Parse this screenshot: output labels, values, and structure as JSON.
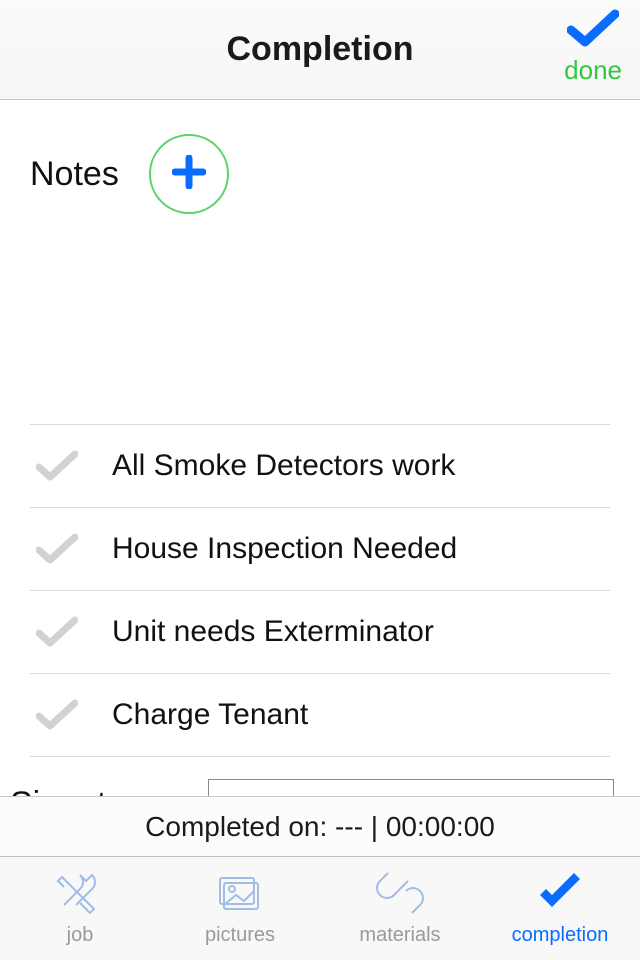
{
  "header": {
    "title": "Completion",
    "done_label": "done"
  },
  "notes": {
    "label": "Notes"
  },
  "checklist": {
    "items": [
      {
        "label": "All Smoke Detectors work"
      },
      {
        "label": "House Inspection Needed"
      },
      {
        "label": "Unit needs Exterminator"
      },
      {
        "label": "Charge Tenant"
      }
    ]
  },
  "signature": {
    "label": "Signature"
  },
  "status": {
    "text": "Completed on: --- | 00:00:00"
  },
  "tabs": {
    "items": [
      {
        "label": "job"
      },
      {
        "label": "pictures"
      },
      {
        "label": "materials"
      },
      {
        "label": "completion"
      }
    ]
  }
}
